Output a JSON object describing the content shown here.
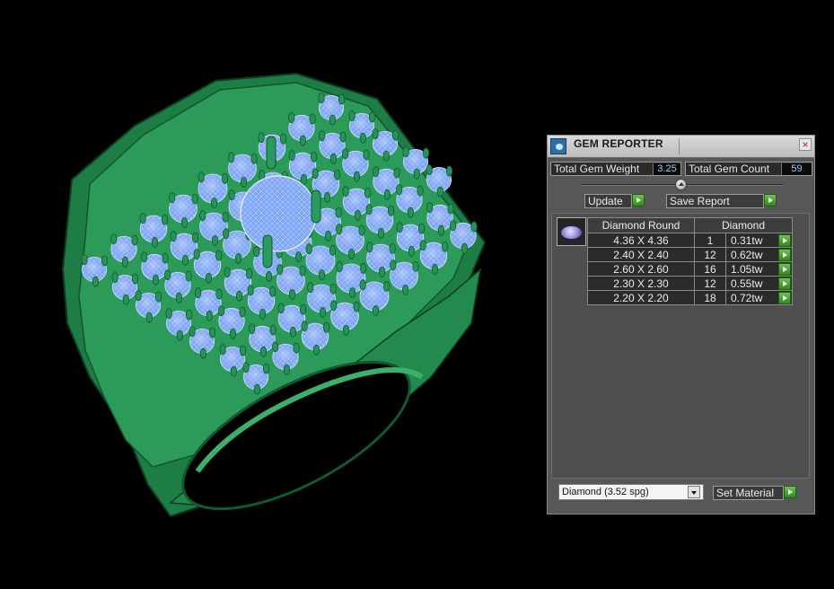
{
  "panel": {
    "title": "GEM REPORTER",
    "close_symbol": "×",
    "icon": "gem-reporter-icon",
    "total_weight_label": "Total Gem Weight",
    "total_weight_value": "3.25",
    "total_count_label": "Total Gem Count",
    "total_count_value": "59",
    "update_label": "Update",
    "save_report_label": "Save Report",
    "table": {
      "headers": [
        "Diamond Round",
        "Diamond"
      ],
      "rows": [
        {
          "size": "4.36 X 4.36",
          "count": "1",
          "weight": "0.31tw"
        },
        {
          "size": "2.40 X 2.40",
          "count": "12",
          "weight": "0.62tw"
        },
        {
          "size": "2.60 X 2.60",
          "count": "16",
          "weight": "1.05tw"
        },
        {
          "size": "2.30 X 2.30",
          "count": "12",
          "weight": "0.55tw"
        },
        {
          "size": "2.20 X 2.20",
          "count": "18",
          "weight": "0.72tw"
        }
      ]
    },
    "material_select_value": "Diamond     (3.52 spg)",
    "set_material_label": "Set Material"
  },
  "colors": {
    "background": "#000000",
    "ring_metal": "#1f8a4e",
    "gem_wireframe": "#7fa8ff",
    "panel_bg": "#575757",
    "value_text": "#8fd0ff",
    "action_green": "#3fa32a"
  }
}
